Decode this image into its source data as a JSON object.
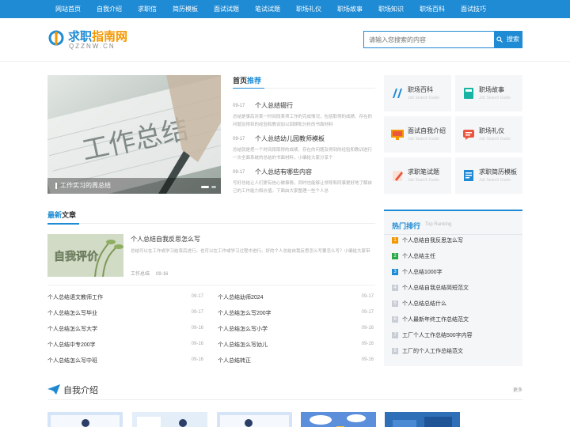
{
  "nav": [
    "网站首页",
    "自我介绍",
    "求职信",
    "简历模板",
    "面试试题",
    "笔试试题",
    "职场礼仪",
    "职场故事",
    "职场知识",
    "职场百科",
    "面试技巧"
  ],
  "logo": {
    "text_a": "求职",
    "text_b": "指南网",
    "sub": "QZZNW.CN"
  },
  "search": {
    "placeholder": "请输入您搜索的内容",
    "button": "搜索"
  },
  "banner": {
    "caption": "工作实习的周总结",
    "image_text": "工作总结"
  },
  "featured": {
    "title_a": "首页",
    "title_b": "推荐",
    "items": [
      {
        "date": "09-17",
        "title": "个人总结辍行",
        "desc": "总结是事后对某一时间段某项工作的完成情况，包括取得的成绩、存在的问题及得到的经验和教训加以回顾和分析的书面材料"
      },
      {
        "date": "09-17",
        "title": "个人总结幼儿园教师模板",
        "desc": "总结就是把一个时间段取得的成绩、存在的问题及得到的经验和教训进行一次全面系统的总结的书面材料，小编给大家分享个"
      },
      {
        "date": "09-17",
        "title": "个人总结有哪些内容",
        "desc": "写好总结让人们更有信心做事情，同时也能够让领导和同事更好地了解自己的工作能力和价值。下面由大家整理一些个人总"
      }
    ]
  },
  "categories": [
    {
      "name": "职场百科",
      "en": "Job Search Guide",
      "icon": "book-icon",
      "color": "#1e8bd4"
    },
    {
      "name": "职场故事",
      "en": "Job Search Guide",
      "icon": "notebook-icon",
      "color": "#17b3a3"
    },
    {
      "name": "面试自我介绍",
      "en": "Job Search Guide",
      "icon": "monitor-icon",
      "color": "#f39800"
    },
    {
      "name": "职场礼仪",
      "en": "Job Search Guide",
      "icon": "chat-icon",
      "color": "#e9573f"
    },
    {
      "name": "求职笔试题",
      "en": "Job Search Guide",
      "icon": "pen-icon",
      "color": "#e9573f"
    },
    {
      "name": "求职简历模板",
      "en": "Job Search Guide",
      "icon": "document-icon",
      "color": "#1e8bd4"
    }
  ],
  "latest": {
    "title_a": "最新",
    "title_b": "文章",
    "main": {
      "title": "个人总结自我反思怎么写",
      "desc": "总结可以在工作或学习结束后进行，也可以在工作或学习过程中进行。好的个人总结自我反思怎么写要怎么写？小编给大家带",
      "category": "工作总结",
      "date": "09-16",
      "image_text": "自我评价"
    },
    "items": [
      {
        "title": "个人总结语文教师工作",
        "date": "09-17"
      },
      {
        "title": "个人总结幼师2024",
        "date": "09-17"
      },
      {
        "title": "个人总结怎么写毕业",
        "date": "09-17"
      },
      {
        "title": "个人总结怎么写200字",
        "date": "09-17"
      },
      {
        "title": "个人总结怎么写大学",
        "date": "09-16"
      },
      {
        "title": "个人总结怎么写小学",
        "date": "09-16"
      },
      {
        "title": "个人总结中专200字",
        "date": "09-16"
      },
      {
        "title": "个人总结怎么写幼儿",
        "date": "09-16"
      },
      {
        "title": "个人总结怎么写中班",
        "date": "09-16"
      },
      {
        "title": "个人总结转正",
        "date": "09-16"
      }
    ]
  },
  "hot": {
    "title": "热门排行",
    "en": "Top Ranking",
    "items": [
      {
        "num": "1",
        "title": "个人总结自我反思怎么写",
        "color": "#f39800"
      },
      {
        "num": "2",
        "title": "个人总结主任",
        "color": "#2aa844"
      },
      {
        "num": "3",
        "title": "个人总结1000字",
        "color": "#1e8bd4"
      },
      {
        "num": "4",
        "title": "个人总结自我总结简短范文",
        "color": "#c9ced4"
      },
      {
        "num": "5",
        "title": "个人总结总结什么",
        "color": "#c9ced4"
      },
      {
        "num": "6",
        "title": "个人最新年终工作总结范文",
        "color": "#c9ced4"
      },
      {
        "num": "7",
        "title": "工厂个人工作总结500字内容",
        "color": "#c9ced4"
      },
      {
        "num": "8",
        "title": "工厂的个人工作总结范文",
        "color": "#c9ced4"
      }
    ]
  },
  "intro": {
    "title": "自我介绍",
    "more": "更多"
  }
}
